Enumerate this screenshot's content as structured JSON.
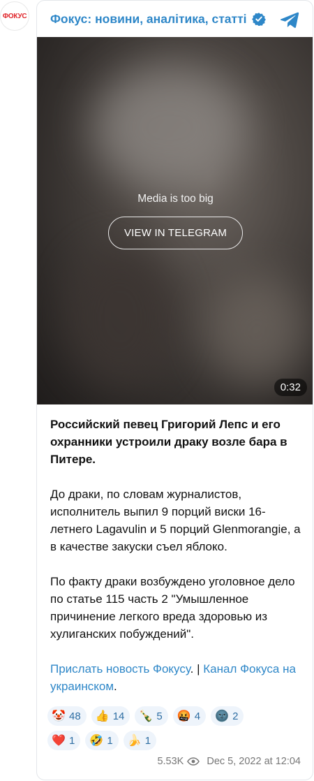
{
  "channel": {
    "avatar_text": "ФОКУС",
    "name": "Фокус: новини, аналітика, статті"
  },
  "media": {
    "note": "Media is too big",
    "button_label": "VIEW IN TELEGRAM",
    "duration": "0:32"
  },
  "post": {
    "headline": "Российский певец Григорий Лепс и его охранники устроили драку возле бара в Питере.",
    "paragraph1": "До драки, по словам журналистов, исполнитель выпил 9 порций виски 16-летнего Lagavulin и 5 порций Glenmorangie, а в качестве закуски съел яблоко.",
    "paragraph2": "По факту драки возбуждено уголовное дело по статье 115 часть 2 \"Умышленное причинение легкого вреда здоровью из хулиганских побуждений\".",
    "links": {
      "send_prefix": "Прислать новость ",
      "send_italic": "Фокусу",
      "separator": ". | ",
      "channel_prefix": "Канал ",
      "channel_italic": "Фокуса",
      "channel_suffix": " на украинском",
      "end": "."
    }
  },
  "reactions": [
    {
      "emoji": "🤡",
      "count": "48"
    },
    {
      "emoji": "👍",
      "count": "14"
    },
    {
      "emoji": "🍾",
      "count": "5"
    },
    {
      "emoji": "🤬",
      "count": "4"
    },
    {
      "emoji": "🌚",
      "count": "2"
    },
    {
      "emoji": "❤️",
      "count": "1"
    },
    {
      "emoji": "🤣",
      "count": "1"
    },
    {
      "emoji": "🍌",
      "count": "1"
    }
  ],
  "footer": {
    "views": "5.53K",
    "date": "Dec 5, 2022 at 12:04"
  },
  "colors": {
    "accent": "#2e87c8",
    "brand_red": "#e0262b",
    "reaction_bg": "#eef4fb"
  },
  "icons": {
    "verified": "verified-badge-icon",
    "telegram": "telegram-icon",
    "views": "eye-icon"
  }
}
